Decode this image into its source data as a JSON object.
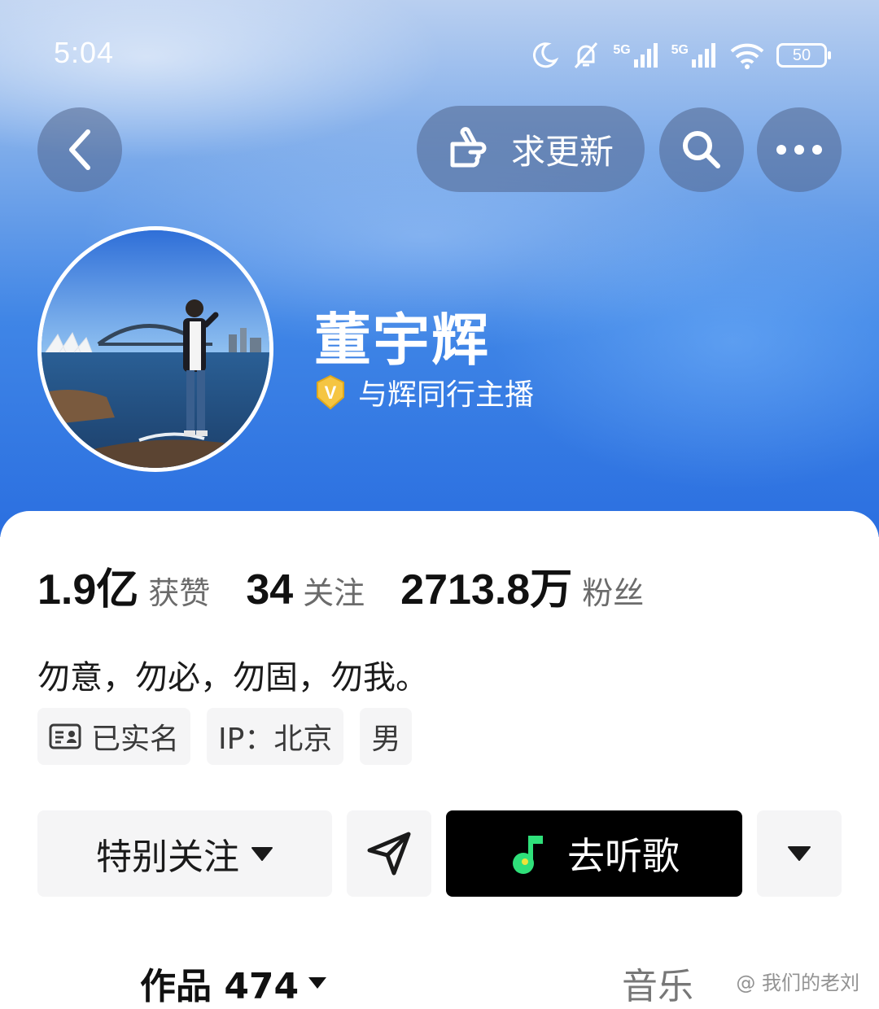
{
  "status_bar": {
    "time": "5:04",
    "network_1": "5G",
    "network_2": "5G",
    "battery": "50"
  },
  "header": {
    "request_update_label": "求更新",
    "icons": [
      "back-icon",
      "pointing-hand-icon",
      "search-icon",
      "more-icon"
    ]
  },
  "profile": {
    "name": "董宇辉",
    "verify_label": "与辉同行主播",
    "verify_badge": "V"
  },
  "stats": [
    {
      "value": "1.9亿",
      "label": "获赞"
    },
    {
      "value": "34",
      "label": "关注"
    },
    {
      "value": "2713.8万",
      "label": "粉丝"
    }
  ],
  "bio": "勿意，勿必，勿固，勿我。",
  "tags": {
    "real_name": "已实名",
    "ip": "IP：北京",
    "gender": "男"
  },
  "actions": {
    "follow_label": "特别关注",
    "music_label": "去听歌"
  },
  "tabs": {
    "works_label": "作品 474",
    "music_label": "音乐"
  },
  "watermark": "@ 我们的老刘"
}
